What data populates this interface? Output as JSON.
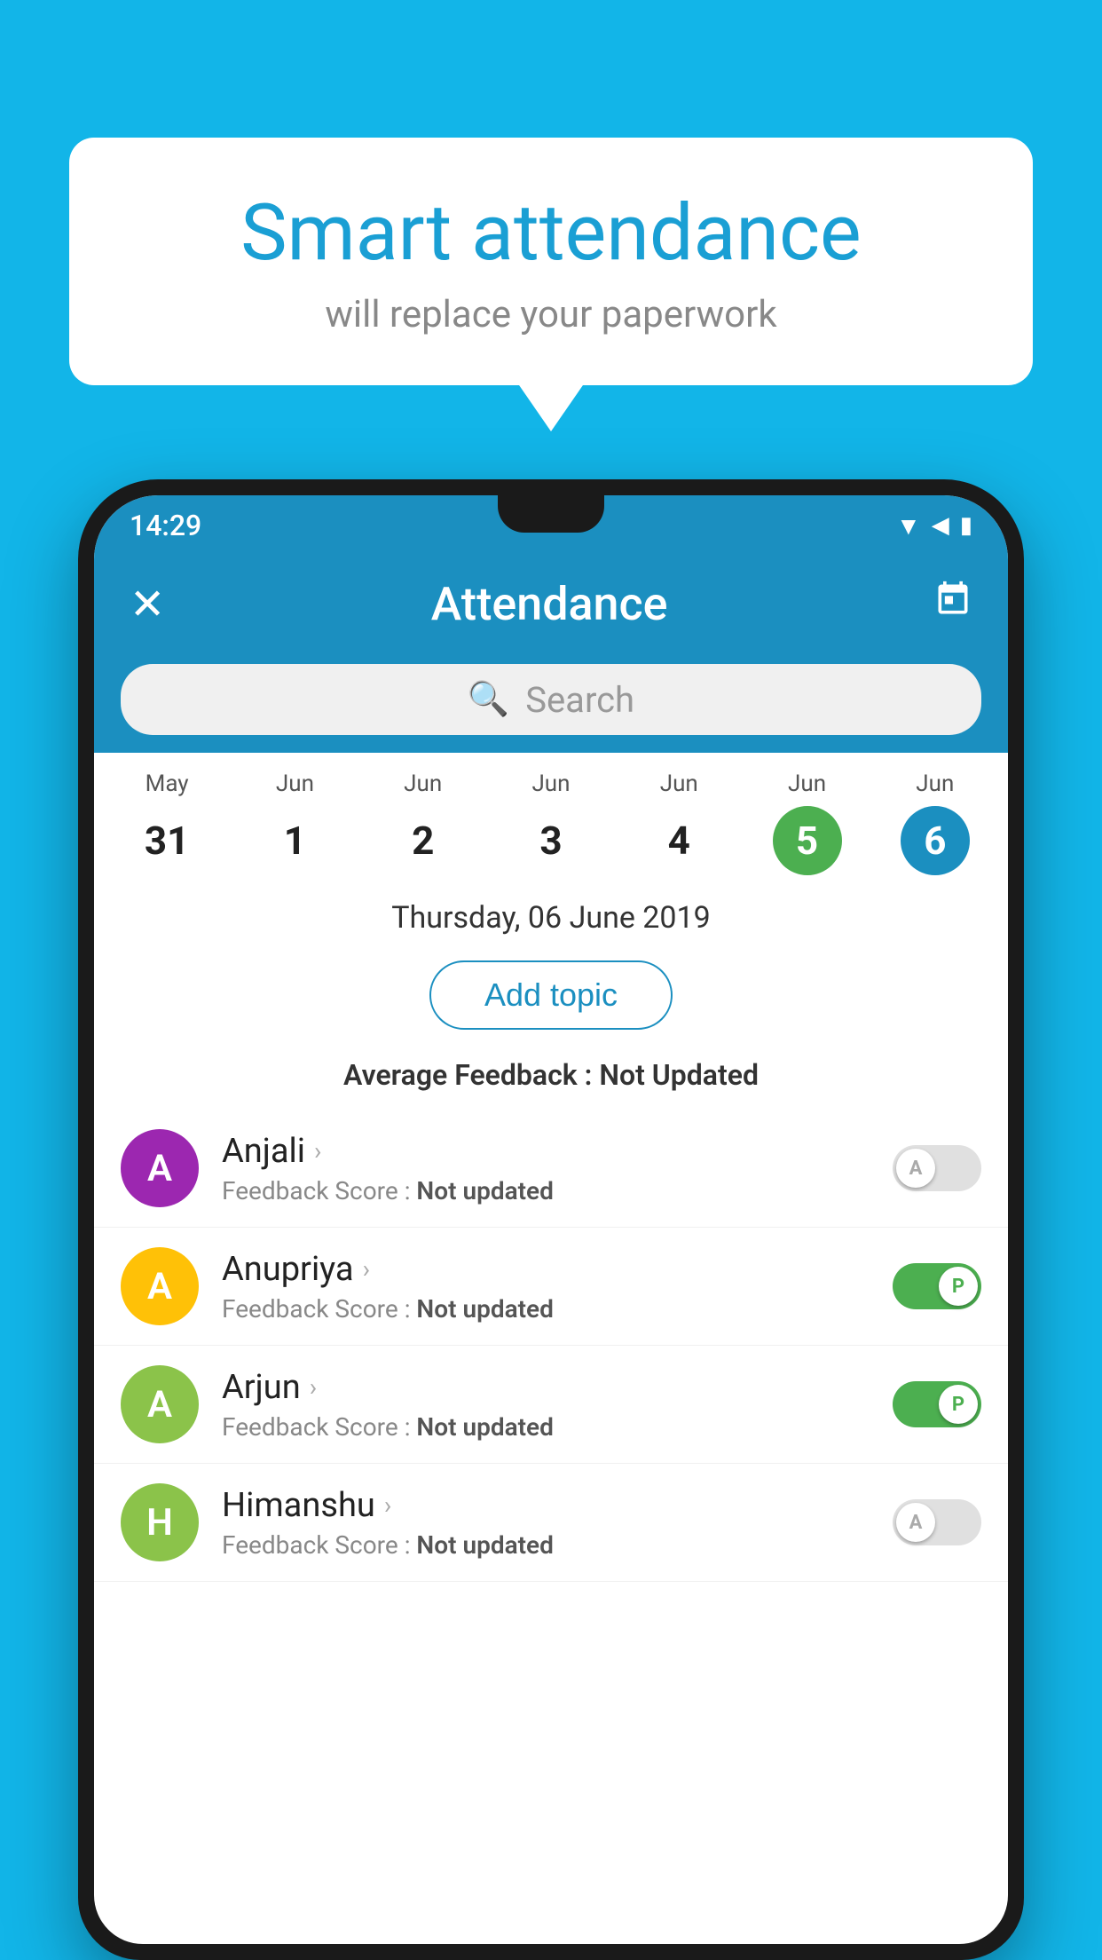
{
  "background_color": "#12b5e8",
  "bubble": {
    "title": "Smart attendance",
    "subtitle": "will replace your paperwork"
  },
  "status_bar": {
    "time": "14:29",
    "icons": [
      "wifi",
      "signal",
      "battery"
    ]
  },
  "app_bar": {
    "title": "Attendance",
    "close_icon": "✕",
    "calendar_icon": "📅"
  },
  "search": {
    "placeholder": "Search"
  },
  "calendar": {
    "days": [
      {
        "month": "May",
        "date": "31",
        "style": "normal"
      },
      {
        "month": "Jun",
        "date": "1",
        "style": "normal"
      },
      {
        "month": "Jun",
        "date": "2",
        "style": "normal"
      },
      {
        "month": "Jun",
        "date": "3",
        "style": "normal"
      },
      {
        "month": "Jun",
        "date": "4",
        "style": "normal"
      },
      {
        "month": "Jun",
        "date": "5",
        "style": "green"
      },
      {
        "month": "Jun",
        "date": "6",
        "style": "blue"
      }
    ],
    "selected_date": "Thursday, 06 June 2019"
  },
  "add_topic_label": "Add topic",
  "average_feedback_label": "Average Feedback : ",
  "average_feedback_value": "Not Updated",
  "students": [
    {
      "name": "Anjali",
      "avatar_letter": "A",
      "avatar_color": "#9c27b0",
      "feedback_label": "Feedback Score : ",
      "feedback_value": "Not updated",
      "toggle_state": "off",
      "toggle_label": "A"
    },
    {
      "name": "Anupriya",
      "avatar_letter": "A",
      "avatar_color": "#ffc107",
      "feedback_label": "Feedback Score : ",
      "feedback_value": "Not updated",
      "toggle_state": "on",
      "toggle_label": "P"
    },
    {
      "name": "Arjun",
      "avatar_letter": "A",
      "avatar_color": "#8bc34a",
      "feedback_label": "Feedback Score : ",
      "feedback_value": "Not updated",
      "toggle_state": "on",
      "toggle_label": "P"
    },
    {
      "name": "Himanshu",
      "avatar_letter": "H",
      "avatar_color": "#8bc34a",
      "feedback_label": "Feedback Score : ",
      "feedback_value": "Not updated",
      "toggle_state": "off",
      "toggle_label": "A"
    }
  ]
}
